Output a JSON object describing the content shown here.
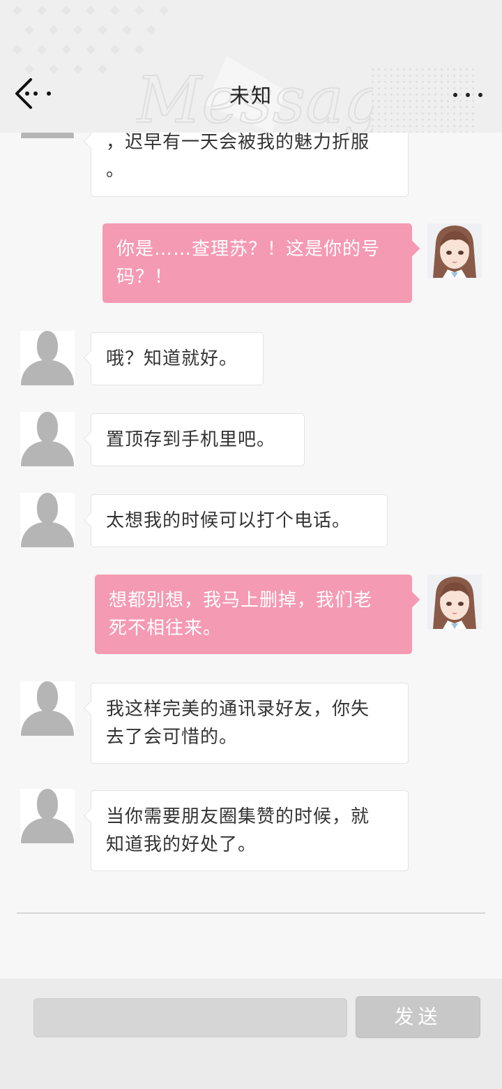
{
  "header": {
    "title": "未知",
    "watermark_text": "Message"
  },
  "messages": [
    {
      "side": "left",
      "lines": [
        "，迟早有一天会被我的魅力折服",
        "。"
      ]
    },
    {
      "side": "right",
      "lines": [
        "你是……查理苏？！这是你的号",
        "码？！"
      ]
    },
    {
      "side": "left",
      "lines": [
        "哦？知道就好。"
      ]
    },
    {
      "side": "left",
      "lines": [
        "置顶存到手机里吧。"
      ]
    },
    {
      "side": "left",
      "lines": [
        "太想我的时候可以打个电话。"
      ]
    },
    {
      "side": "right",
      "lines": [
        "想都别想，我马上删掉，我们老",
        "死不相往来。"
      ]
    },
    {
      "side": "left",
      "lines": [
        "我这样完美的通讯录好友，你失",
        "去了会可惜的。"
      ]
    },
    {
      "side": "left",
      "lines": [
        "当你需要朋友圈集赞的时候，就",
        "知道我的好处了。"
      ]
    }
  ],
  "input": {
    "value": "",
    "placeholder": ""
  },
  "send_label": "发送",
  "colors": {
    "accent_pink": "#f59ab3",
    "header_bg": "#efefef",
    "bubble_bg": "#ffffff",
    "send_bg": "#c8c8c8"
  },
  "icons": {
    "back": "back-arrow-icon",
    "more": "more-dots-icon"
  }
}
